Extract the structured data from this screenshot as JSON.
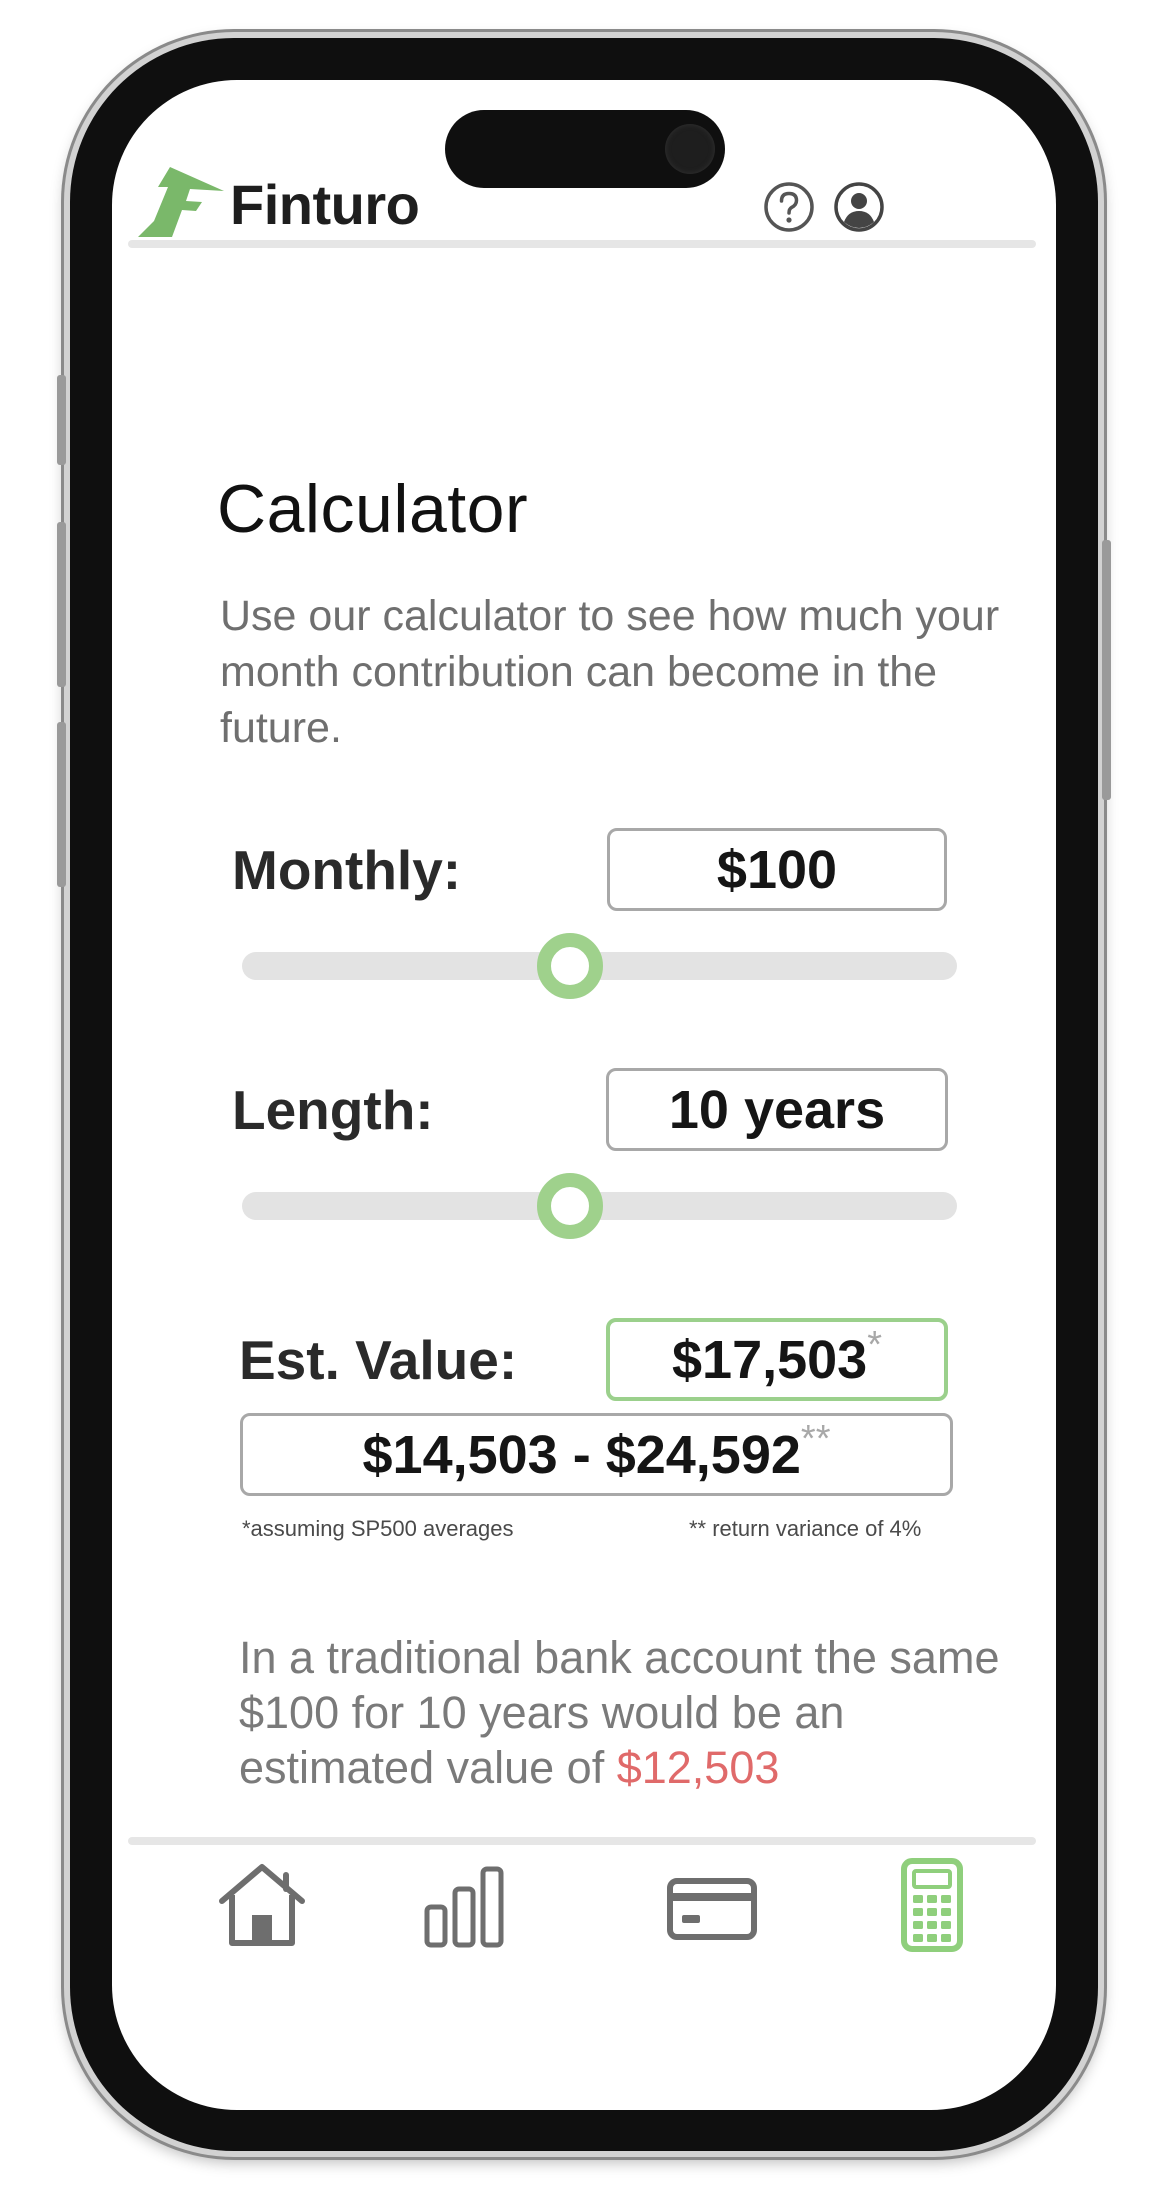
{
  "app": {
    "brand_name": "Finturo",
    "brand_color": "#7ab86a"
  },
  "header": {
    "icons": [
      "help-icon",
      "account-icon"
    ]
  },
  "calculator": {
    "title": "Calculator",
    "description": "Use our calculator to see how much your month contribution can become in the future.",
    "monthly": {
      "label": "Monthly:",
      "value": "$100",
      "slider_fraction": 0.5
    },
    "length": {
      "label": "Length:",
      "value": "10 years",
      "slider_fraction": 0.5
    },
    "estimate": {
      "label": "Est. Value:",
      "value": "$17,503",
      "value_marker": "*",
      "range": "$14,503 - $24,592",
      "range_marker": "**",
      "footnote_left": "*assuming SP500 averages",
      "footnote_right": "** return variance of 4%"
    },
    "comparison": {
      "text": "In a traditional bank account the same $100 for 10 years would be an estimated value of ",
      "value": "$12,503",
      "value_color": "#e06a6a"
    }
  },
  "nav": {
    "items": [
      {
        "icon": "home-icon",
        "active": false
      },
      {
        "icon": "bar-chart-icon",
        "active": false
      },
      {
        "icon": "card-icon",
        "active": false
      },
      {
        "icon": "calculator-icon",
        "active": true
      }
    ],
    "active_color": "#8fcf7c",
    "inactive_color": "#6e6e6e"
  }
}
